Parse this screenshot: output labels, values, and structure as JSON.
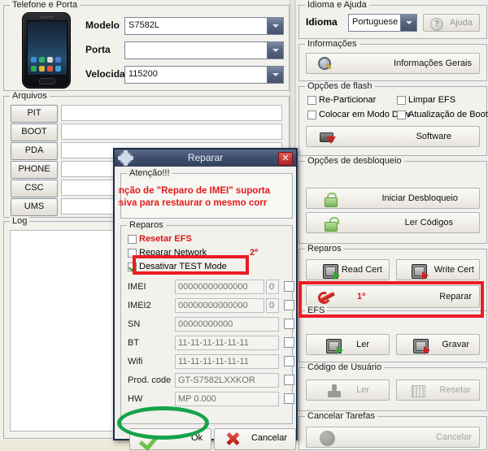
{
  "left": {
    "phone_group": {
      "title": "Telefone e Porta",
      "fields": [
        {
          "label": "Modelo",
          "value": "S7582L"
        },
        {
          "label": "Porta",
          "value": ""
        },
        {
          "label": "Velocidade",
          "value": "115200"
        }
      ]
    },
    "files_group": {
      "title": "Arquivos",
      "rows": [
        {
          "label": "PIT",
          "value": ""
        },
        {
          "label": "BOOT",
          "value": ""
        },
        {
          "label": "PDA",
          "value": ""
        },
        {
          "label": "PHONE",
          "value": ""
        },
        {
          "label": "CSC",
          "value": ""
        },
        {
          "label": "UMS",
          "value": ""
        }
      ]
    },
    "log_group": {
      "title": "Log",
      "content": ""
    }
  },
  "right": {
    "language_group": {
      "title": "Idioma e Ajuda",
      "label": "Idioma",
      "selected": "Portuguese (B",
      "help_label": "Ajuda"
    },
    "info_group": {
      "title": "Informações",
      "button": "Informações Gerais"
    },
    "flash_group": {
      "title": "Opções de flash",
      "checkboxes": [
        {
          "label": "Re-Particionar",
          "checked": false
        },
        {
          "label": "Limpar EFS",
          "checked": false
        },
        {
          "label": "Colocar em Modo Dow",
          "checked": false
        },
        {
          "label": "Atualização de Boot",
          "checked": false
        }
      ],
      "button": "Software"
    },
    "unlock_group": {
      "title": "Opções de desbloqueio",
      "buttons": [
        "Iniciar Desbloqueio",
        "Ler Códigos"
      ]
    },
    "repairs_group": {
      "title": "Reparos",
      "read_cert": "Read Cert",
      "write_cert": "Write Cert",
      "reparar": "Reparar",
      "reparar_order": "1º"
    },
    "efs_group": {
      "title": "EFS",
      "buttons": [
        "Ler",
        "Gravar"
      ]
    },
    "user_group": {
      "title": "Código de Usuário",
      "buttons": [
        "Ler",
        "Resetar"
      ]
    },
    "cancel_group": {
      "title": "Cancelar Tarefas",
      "button": "Cancelar"
    }
  },
  "dialog": {
    "title": "Reparar",
    "close": "✕",
    "attention": {
      "title": "Atenção!!!",
      "line1": "unção de \"Reparo de IMEI\" suporta",
      "line2": "usiva para restaurar o mesmo corr"
    },
    "repairs": {
      "title": "Reparos",
      "checkboxes": [
        {
          "label": "Resetar EFS",
          "checked": false
        },
        {
          "label": "Reparar Network",
          "checked": false
        },
        {
          "label": "Desativar TEST Mode",
          "checked": true
        }
      ],
      "order_marker": "2º"
    },
    "fields": [
      {
        "label": "IMEI",
        "value": "00000000000000",
        "extra": "0",
        "checked": false
      },
      {
        "label": "IMEI2",
        "value": "00000000000000",
        "extra": "0",
        "checked": false
      },
      {
        "label": "SN",
        "value": "00000000000",
        "extra": "",
        "checked": false
      },
      {
        "label": "BT",
        "value": "11-11-11-11-11-11",
        "extra": "",
        "checked": false
      },
      {
        "label": "Wifi",
        "value": "11-11-11-11-11-11",
        "extra": "",
        "checked": false
      },
      {
        "label": "Prod. code",
        "value": "GT-S7582LXXKOR",
        "extra": "",
        "checked": false
      },
      {
        "label": "HW",
        "value": "MP 0.000",
        "extra": "",
        "checked": false
      }
    ],
    "ok_label": "Ok",
    "cancel_label": "Cancelar"
  },
  "colors": {
    "highlight_red": "#ec1c24",
    "highlight_green": "#16a34a",
    "warning_text": "#e21b1b"
  }
}
